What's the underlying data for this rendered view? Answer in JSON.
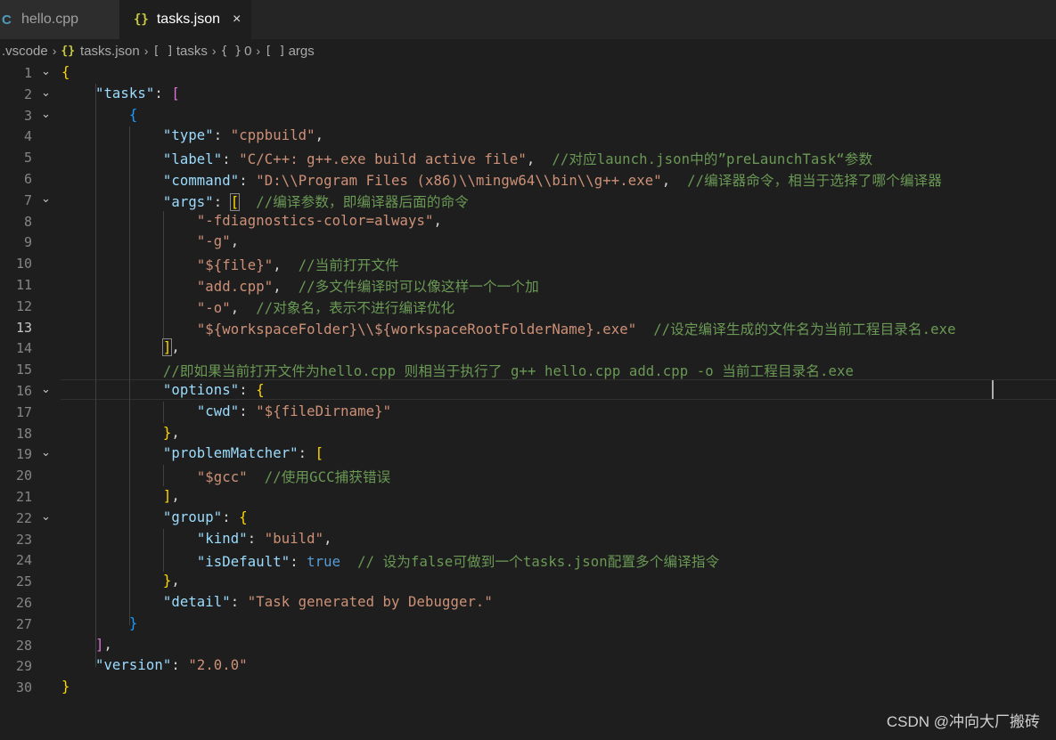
{
  "tabs": [
    {
      "label": "hello.cpp",
      "icon": "c-file-icon"
    },
    {
      "label": "tasks.json",
      "icon": "json-file-icon",
      "close": "×"
    }
  ],
  "breadcrumb": {
    "folder": ".vscode",
    "file": "tasks.json",
    "items": [
      "tasks",
      "0",
      "args"
    ],
    "symbols": [
      "[ ]",
      "{ }",
      "[ ]"
    ]
  },
  "watermark": "CSDN @冲向大厂搬砖",
  "active_line": 13,
  "lines": [
    {
      "n": "1",
      "fold": "⌄",
      "html": "<span class=\"b1\">{</span>"
    },
    {
      "n": "2",
      "fold": "⌄",
      "html": "    <span class=\"k\">\"tasks\"</span><span class=\"p\">: </span><span class=\"b2\">[</span>"
    },
    {
      "n": "3",
      "fold": "⌄",
      "html": "        <span class=\"b3\">{</span>"
    },
    {
      "n": "4",
      "fold": "",
      "html": "            <span class=\"k\">\"type\"</span><span class=\"p\">: </span><span class=\"s\">\"cppbuild\"</span><span class=\"p\">,</span>"
    },
    {
      "n": "5",
      "fold": "",
      "html": "            <span class=\"k\">\"label\"</span><span class=\"p\">: </span><span class=\"s\">\"C/C++: g++.exe build active file\"</span><span class=\"p\">,  </span><span class=\"cm\">//对应launch.json中的”preLaunchTask“参数</span>"
    },
    {
      "n": "6",
      "fold": "",
      "html": "            <span class=\"k\">\"command\"</span><span class=\"p\">: </span><span class=\"s\">\"D:\\\\Program Files (x86)\\\\mingw64\\\\bin\\\\g++.exe\"</span><span class=\"p\">,  </span><span class=\"cm\">//编译器命令，相当于选择了哪个编译器</span>"
    },
    {
      "n": "7",
      "fold": "⌄",
      "html": "            <span class=\"k\">\"args\"</span><span class=\"p\">: </span><span class=\"b1 bracket-box\">[</span><span class=\"p\">  </span><span class=\"cm\">//编译参数，即编译器后面的命令</span>"
    },
    {
      "n": "8",
      "fold": "",
      "html": "                <span class=\"s\">\"-fdiagnostics-color=always\"</span><span class=\"p\">,</span>"
    },
    {
      "n": "9",
      "fold": "",
      "html": "                <span class=\"s\">\"-g\"</span><span class=\"p\">,</span>"
    },
    {
      "n": "10",
      "fold": "",
      "html": "                <span class=\"s\">\"${file}\"</span><span class=\"p\">,  </span><span class=\"cm\">//当前打开文件</span>"
    },
    {
      "n": "11",
      "fold": "",
      "html": "                <span class=\"s\">\"add.cpp\"</span><span class=\"p\">,  </span><span class=\"cm\">//多文件编译时可以像这样一个一个加</span>"
    },
    {
      "n": "12",
      "fold": "",
      "html": "                <span class=\"s\">\"-o\"</span><span class=\"p\">,  </span><span class=\"cm\">//对象名，表示不进行编译优化</span>"
    },
    {
      "n": "13",
      "fold": "",
      "html": "                <span class=\"s\">\"${workspaceFolder}\\\\${workspaceRootFolderName}.exe\"</span><span class=\"p\">  </span><span class=\"cm\">//设定编译生成的文件名为当前工程目录名.exe</span>"
    },
    {
      "n": "14",
      "fold": "",
      "html": "            <span class=\"b1 bracket-box\">]</span><span class=\"p\">,</span>"
    },
    {
      "n": "15",
      "fold": "",
      "html": "            <span class=\"cm\">//即如果当前打开文件为hello.cpp 则相当于执行了 g++ hello.cpp add.cpp -o 当前工程目录名.exe</span>"
    },
    {
      "n": "16",
      "fold": "⌄",
      "html": "            <span class=\"k\">\"options\"</span><span class=\"p\">: </span><span class=\"b1\">{</span>"
    },
    {
      "n": "17",
      "fold": "",
      "html": "                <span class=\"k\">\"cwd\"</span><span class=\"p\">: </span><span class=\"s\">\"${fileDirname}\"</span>"
    },
    {
      "n": "18",
      "fold": "",
      "html": "            <span class=\"b1\">}</span><span class=\"p\">,</span>"
    },
    {
      "n": "19",
      "fold": "⌄",
      "html": "            <span class=\"k\">\"problemMatcher\"</span><span class=\"p\">: </span><span class=\"b1\">[</span>"
    },
    {
      "n": "20",
      "fold": "",
      "html": "                <span class=\"s\">\"$gcc\"</span><span class=\"p\">  </span><span class=\"cm\">//使用GCC捕获错误</span>"
    },
    {
      "n": "21",
      "fold": "",
      "html": "            <span class=\"b1\">]</span><span class=\"p\">,</span>"
    },
    {
      "n": "22",
      "fold": "⌄",
      "html": "            <span class=\"k\">\"group\"</span><span class=\"p\">: </span><span class=\"b1\">{</span>"
    },
    {
      "n": "23",
      "fold": "",
      "html": "                <span class=\"k\">\"kind\"</span><span class=\"p\">: </span><span class=\"s\">\"build\"</span><span class=\"p\">,</span>"
    },
    {
      "n": "24",
      "fold": "",
      "html": "                <span class=\"k\">\"isDefault\"</span><span class=\"p\">: </span><span class=\"kw\">true</span><span class=\"p\">  </span><span class=\"cm\">// 设为false可做到一个tasks.json配置多个编译指令</span>"
    },
    {
      "n": "25",
      "fold": "",
      "html": "            <span class=\"b1\">}</span><span class=\"p\">,</span>"
    },
    {
      "n": "26",
      "fold": "",
      "html": "            <span class=\"k\">\"detail\"</span><span class=\"p\">: </span><span class=\"s\">\"Task generated by Debugger.\"</span>"
    },
    {
      "n": "27",
      "fold": "",
      "html": "        <span class=\"b3\">}</span>"
    },
    {
      "n": "28",
      "fold": "",
      "html": "    <span class=\"b2\">]</span><span class=\"p\">,</span>"
    },
    {
      "n": "29",
      "fold": "",
      "html": "    <span class=\"k\">\"version\"</span><span class=\"p\">: </span><span class=\"s\">\"2.0.0\"</span>"
    },
    {
      "n": "30",
      "fold": "",
      "html": "<span class=\"b1\">}</span>"
    }
  ]
}
